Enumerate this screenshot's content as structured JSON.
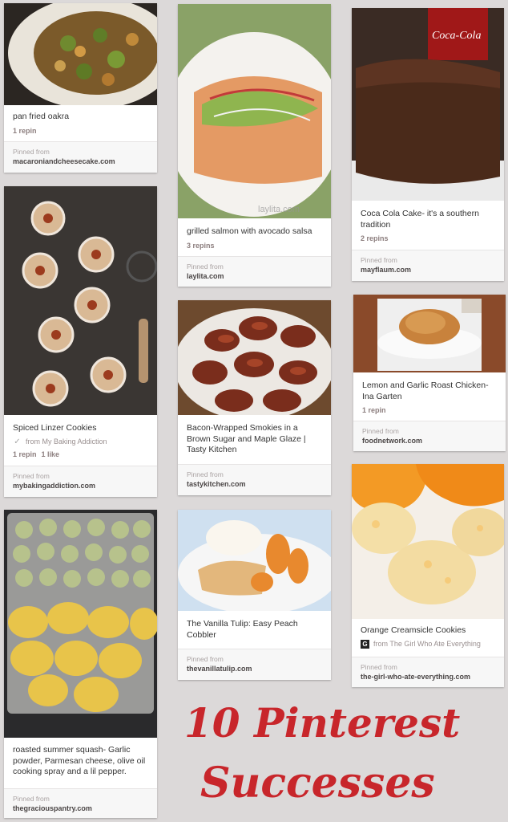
{
  "board": {
    "heading_line1": "10 Pinterest",
    "heading_line2": "Successes",
    "heading_color": "#c8262b"
  },
  "pins": [
    {
      "description": "pan fried oakra",
      "repins": "1 repin",
      "likes": "",
      "via": "",
      "pinned_label": "Pinned from",
      "source": "macaroniandcheesecake.com"
    },
    {
      "description": "Spiced Linzer Cookies",
      "repins": "1 repin",
      "likes": "1 like",
      "via": "from My Baking Addiction",
      "pinned_label": "Pinned from",
      "source": "mybakingaddiction.com"
    },
    {
      "description": "roasted summer squash- Garlic powder, Parmesan cheese, olive oil cooking spray and a lil pepper.",
      "repins": "",
      "likes": "",
      "via": "",
      "pinned_label": "Pinned from",
      "source": "thegraciouspantry.com"
    },
    {
      "description": "grilled salmon with avocado salsa",
      "repins": "3 repins",
      "likes": "",
      "via": "",
      "watermark": "laylita.com",
      "pinned_label": "Pinned from",
      "source": "laylita.com"
    },
    {
      "description": "Bacon-Wrapped Smokies in a Brown Sugar and Maple Glaze | Tasty Kitchen",
      "repins": "",
      "likes": "",
      "via": "",
      "pinned_label": "Pinned from",
      "source": "tastykitchen.com"
    },
    {
      "description": "The Vanilla Tulip: Easy Peach Cobbler",
      "repins": "",
      "likes": "",
      "via": "",
      "pinned_label": "Pinned from",
      "source": "thevanillatulip.com"
    },
    {
      "description": "Coca Cola Cake- it's a southern tradition",
      "repins": "2 repins",
      "likes": "",
      "via": "",
      "pinned_label": "Pinned from",
      "source": "mayflaum.com"
    },
    {
      "description": "Lemon and Garlic Roast Chicken- Ina Garten",
      "repins": "1 repin",
      "likes": "",
      "via": "",
      "pinned_label": "Pinned from",
      "source": "foodnetwork.com"
    },
    {
      "description": "Orange Creamsicle Cookies",
      "repins": "",
      "likes": "",
      "via": "from The Girl Who Ate Everything",
      "via_badge": "G",
      "pinned_label": "Pinned from",
      "source": "the-girl-who-ate-everything.com"
    }
  ]
}
